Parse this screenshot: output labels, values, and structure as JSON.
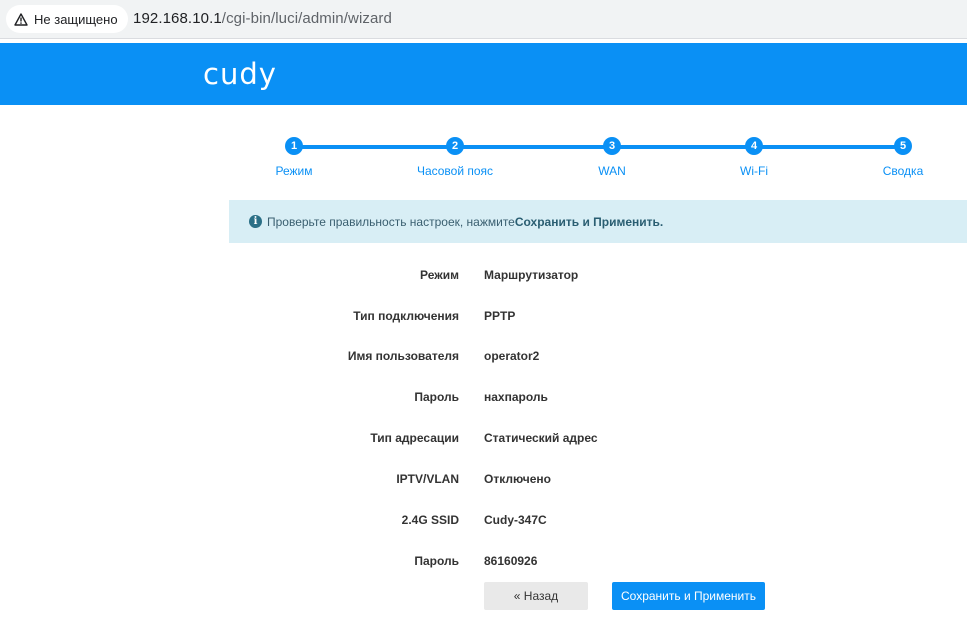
{
  "browser": {
    "security_label": "Не защищено",
    "url_host": "192.168.10.1",
    "url_path": "/cgi-bin/luci/admin/wizard"
  },
  "header": {
    "logo": "cudy"
  },
  "steps": [
    {
      "num": "1",
      "label": "Режим"
    },
    {
      "num": "2",
      "label": "Часовой пояс"
    },
    {
      "num": "3",
      "label": "WAN"
    },
    {
      "num": "4",
      "label": "Wi-Fi"
    },
    {
      "num": "5",
      "label": "Сводка"
    }
  ],
  "info": {
    "text": "Проверьте правильность настроек, нажмите ",
    "highlight": "Сохранить и Применить."
  },
  "summary": [
    {
      "label": "Режим",
      "value": "Маршрутизатор"
    },
    {
      "label": "Тип подключения",
      "value": "PPTP"
    },
    {
      "label": "Имя пользователя",
      "value": "operator2"
    },
    {
      "label": "Пароль",
      "value": "нахпароль"
    },
    {
      "label": "Тип адресации",
      "value": "Статический адрес"
    },
    {
      "label": "IPTV/VLAN",
      "value": "Отключено"
    },
    {
      "label": "2.4G SSID",
      "value": "Cudy-347C"
    },
    {
      "label": "Пароль",
      "value": "86160926"
    }
  ],
  "buttons": {
    "back": "« Назад",
    "save": "Сохранить и Применить"
  },
  "colors": {
    "brand": "#0a90f5",
    "info_bg": "#d8eef5"
  }
}
